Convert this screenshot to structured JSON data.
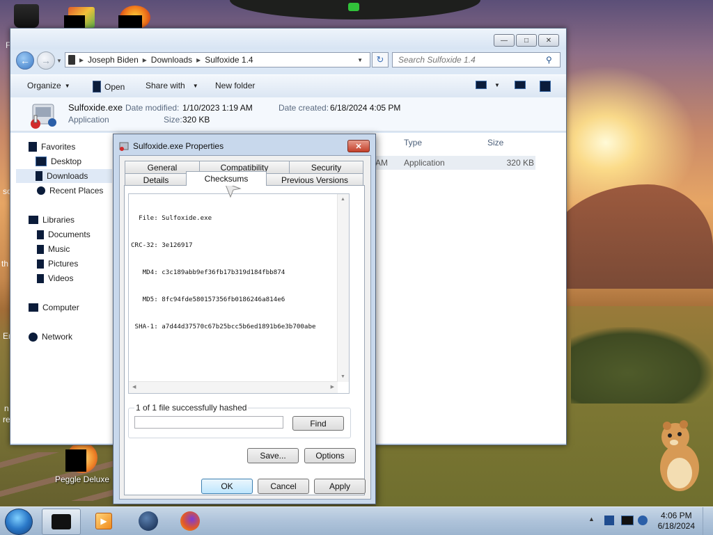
{
  "desktop": {
    "icons": [
      {
        "name": "Peggle Deluxe"
      }
    ],
    "edge_texts": [
      "Fi",
      "sc",
      "th",
      "Er",
      "n",
      "re"
    ]
  },
  "explorer": {
    "breadcrumb": [
      "Joseph Biden",
      "Downloads",
      "Sulfoxide 1.4"
    ],
    "search_placeholder": "Search Sulfoxide 1.4",
    "toolbar": {
      "organize": "Organize",
      "open": "Open",
      "share_with": "Share with",
      "new_folder": "New folder"
    },
    "details_pane": {
      "filename": "Sulfoxide.exe",
      "type": "Application",
      "date_modified_label": "Date modified:",
      "date_modified": "1/10/2023 1:19 AM",
      "size_label": "Size:",
      "size": "320 KB",
      "date_created_label": "Date created:",
      "date_created": "6/18/2024 4:05 PM"
    },
    "nav": {
      "favorites": "Favorites",
      "desktop": "Desktop",
      "downloads": "Downloads",
      "recent_places": "Recent Places",
      "libraries": "Libraries",
      "documents": "Documents",
      "music": "Music",
      "pictures": "Pictures",
      "videos": "Videos",
      "computer": "Computer",
      "network": "Network"
    },
    "columns": {
      "type": "Type",
      "size": "Size"
    },
    "row": {
      "date_fragment": "AM",
      "type": "Application",
      "size": "320 KB"
    }
  },
  "dialog": {
    "title": "Sulfoxide.exe Properties",
    "tabs_row1": [
      "General",
      "Compatibility",
      "Security"
    ],
    "tabs_row2": [
      "Details",
      "Checksums",
      "Previous Versions"
    ],
    "active_tab": "Checksums",
    "hash_lines": [
      "  File: Sulfoxide.exe",
      "CRC-32: 3e126917",
      "   MD4: c3c189abb9ef36fb17b319d184fbb874",
      "   MD5: 8fc94fde580157356fb0186246a814e6",
      " SHA-1: a7d44d37570c67b25bcc5b6ed1891b6e3b700abe"
    ],
    "status_legend": "1 of 1 file successfully hashed",
    "find_value": "",
    "find_button": "Find",
    "save_button": "Save...",
    "options_button": "Options",
    "ok_button": "OK",
    "cancel_button": "Cancel",
    "apply_button": "Apply"
  },
  "taskbar": {
    "time": "4:06 PM",
    "date": "6/18/2024"
  }
}
